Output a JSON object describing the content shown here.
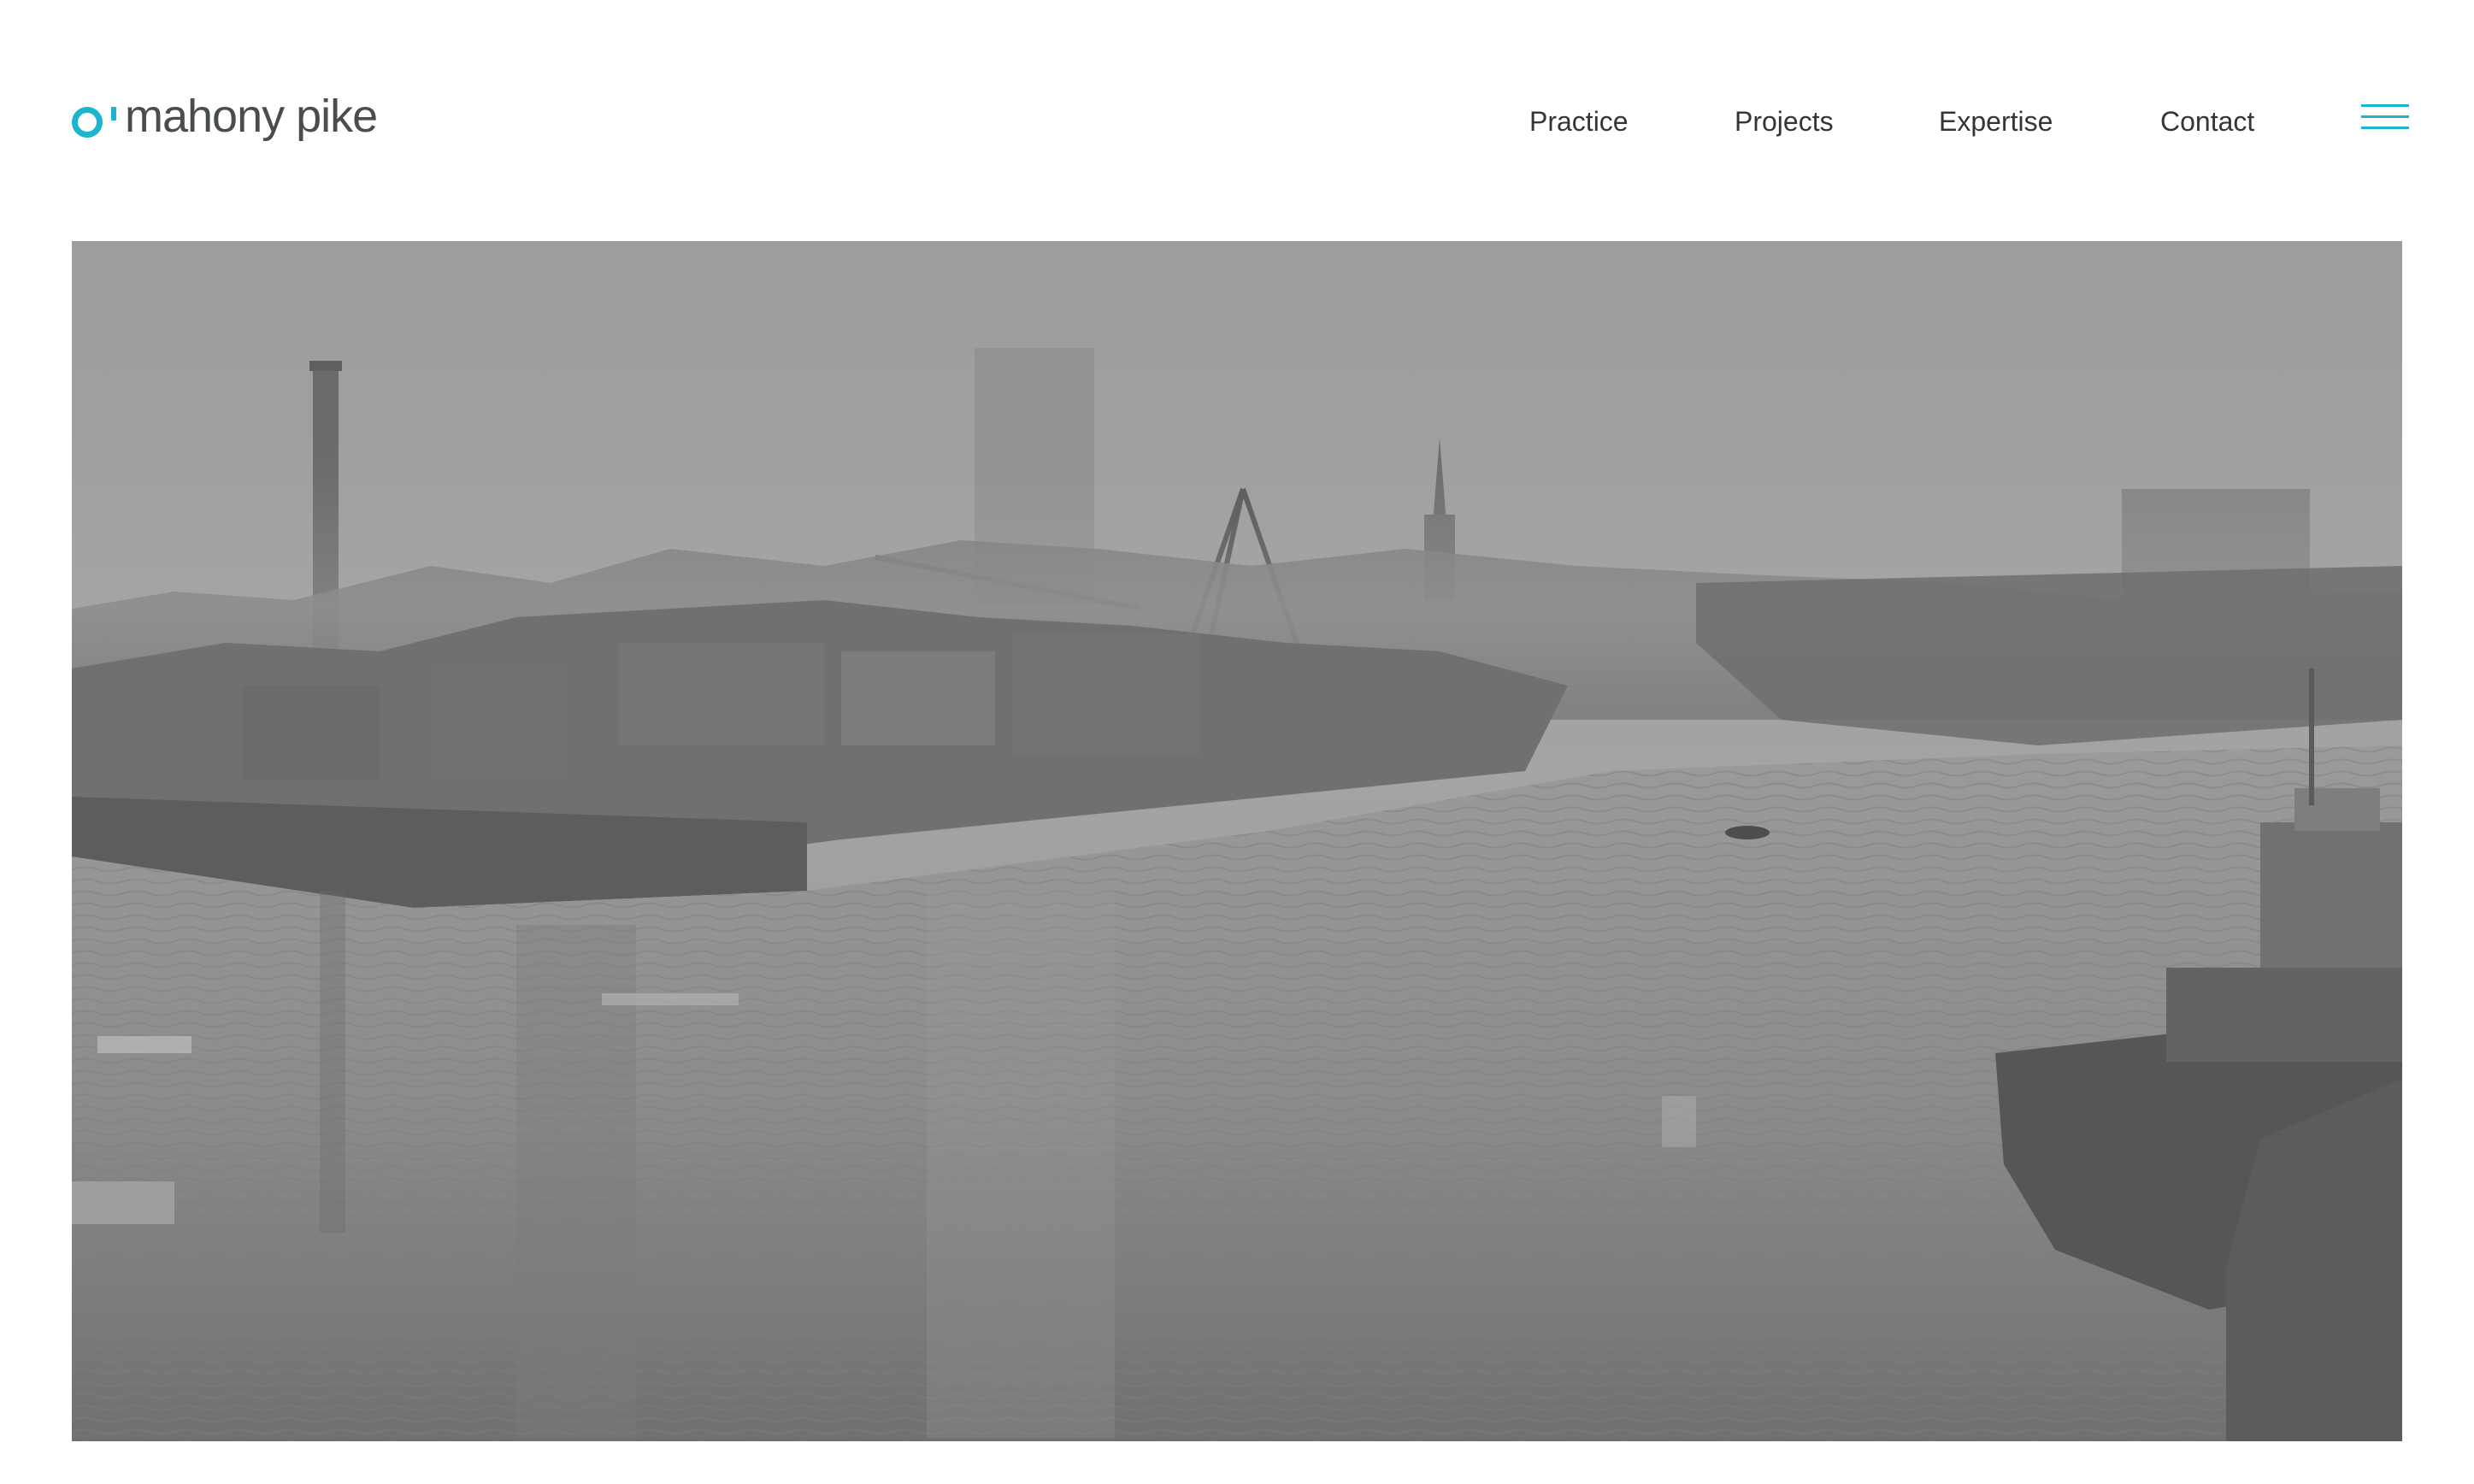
{
  "brand": {
    "name": "mahony pike",
    "accent_color": "#1cb4cf",
    "logo_mark_icon": "o-apostrophe-mark"
  },
  "nav": {
    "items": [
      {
        "label": "Practice"
      },
      {
        "label": "Projects"
      },
      {
        "label": "Expertise"
      },
      {
        "label": "Contact"
      }
    ],
    "menu_icon": "hamburger-icon"
  },
  "hero": {
    "image_subject": "black-and-white harbour photograph"
  }
}
